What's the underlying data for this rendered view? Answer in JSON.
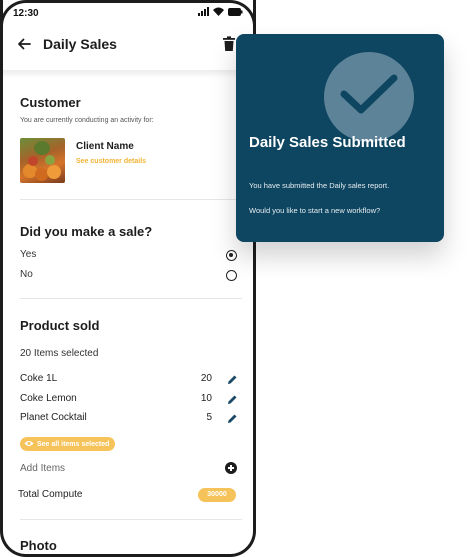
{
  "status_bar": {
    "time": "12:30"
  },
  "app_bar": {
    "title": "Daily Sales"
  },
  "customer": {
    "title": "Customer",
    "subtitle": "You are currently conducting an activity for:",
    "client_name": "Client Name",
    "details_link": "See customer details"
  },
  "sale_question": {
    "title": "Did you make a sale?",
    "options": [
      {
        "label": "Yes",
        "selected": true
      },
      {
        "label": "No",
        "selected": false
      }
    ]
  },
  "product_sold": {
    "title": "Product sold",
    "selected_count": "20 Items selected",
    "items": [
      {
        "name": "Coke 1L",
        "qty": "20"
      },
      {
        "name": "Coke Lemon",
        "qty": "10"
      },
      {
        "name": "Planet Cocktail",
        "qty": "5"
      }
    ],
    "see_all": "See all items selected",
    "add_items": "Add Items",
    "total_label": "Total Compute",
    "total_value": "30000"
  },
  "photo": {
    "title": "Photo"
  },
  "success_card": {
    "title": "Daily Sales Submitted",
    "message_1": "You have submitted the Daily sales report.",
    "message_2": "Would you like to start a new workflow?"
  },
  "colors": {
    "accent": "#f6c35a",
    "card_background": "#0e4560",
    "check_circle": "#5d8398",
    "check_mark": "#0e4560"
  },
  "icons": [
    "back-arrow-icon",
    "trash-icon",
    "pencil-icon",
    "eye-icon",
    "plus-circle-icon",
    "check-icon"
  ]
}
